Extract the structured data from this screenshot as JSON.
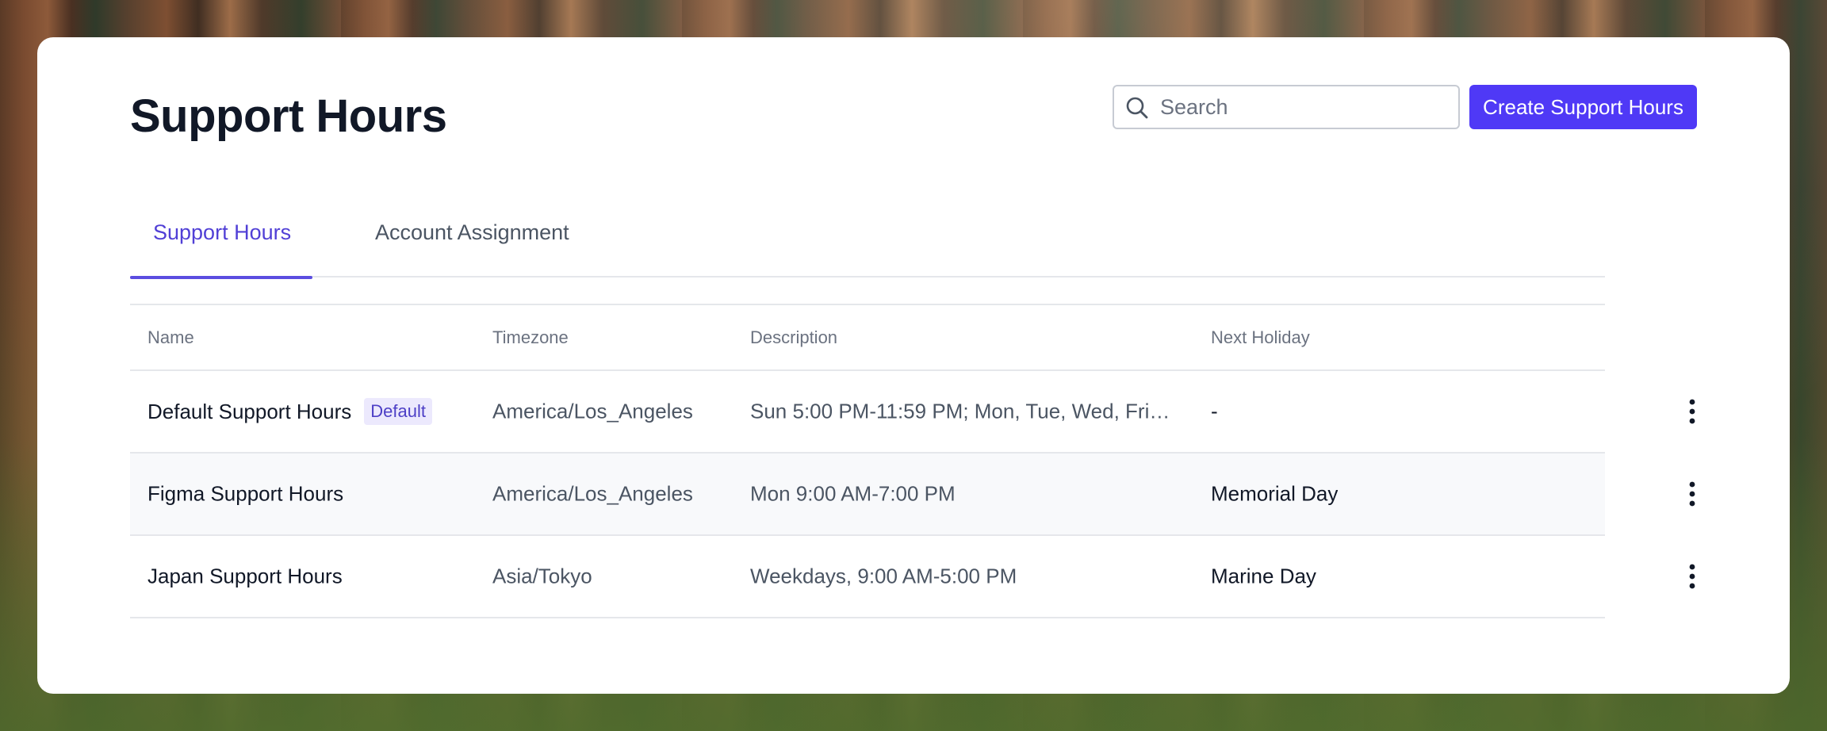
{
  "header": {
    "title": "Support Hours",
    "search_placeholder": "Search",
    "create_button": "Create Support Hours"
  },
  "tabs": [
    {
      "label": "Support Hours",
      "active": true
    },
    {
      "label": "Account Assignment",
      "active": false
    }
  ],
  "table": {
    "columns": {
      "name": "Name",
      "timezone": "Timezone",
      "description": "Description",
      "next_holiday": "Next Holiday"
    },
    "rows": [
      {
        "name": "Default Support Hours",
        "badge": "Default",
        "timezone": "America/Los_Angeles",
        "description": "Sun 5:00 PM-11:59 PM; Mon, Tue, Wed, Fri 1...",
        "next_holiday": "-"
      },
      {
        "name": "Figma Support Hours",
        "timezone": "America/Los_Angeles",
        "description": "Mon 9:00 AM-7:00 PM",
        "next_holiday": "Memorial Day"
      },
      {
        "name": "Japan Support Hours",
        "timezone": "Asia/Tokyo",
        "description": "Weekdays, 9:00 AM-5:00 PM",
        "next_holiday": "Marine Day"
      }
    ]
  },
  "colors": {
    "accent": "#4f39f6",
    "active_tab": "#5140d6",
    "badge_bg": "#ece9fd",
    "badge_text": "#4d3fc6",
    "title_text": "#111827"
  },
  "icons": {
    "search": "search-icon",
    "row_menu": "more-vertical-icon"
  }
}
